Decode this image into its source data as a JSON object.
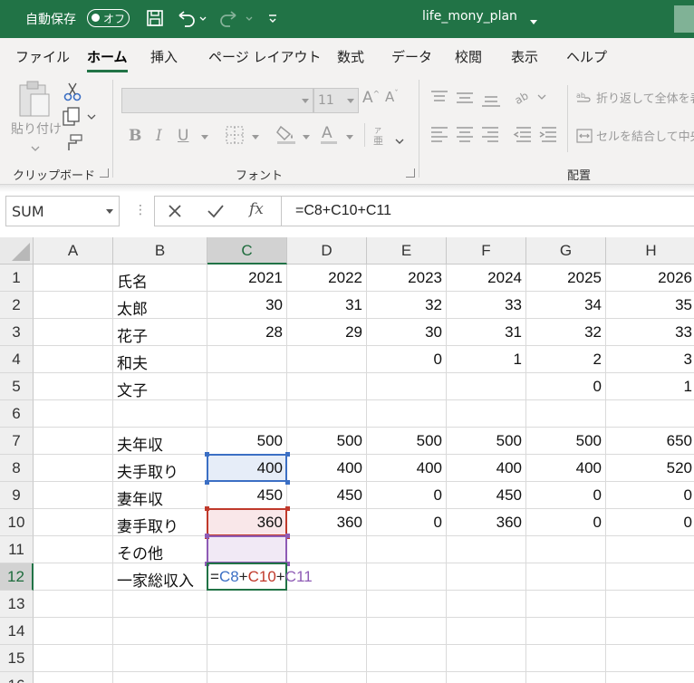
{
  "titlebar": {
    "autosave_label": "自動保存",
    "autosave_toggle": "オフ",
    "file_title": "life_mony_plan"
  },
  "menu": {
    "tabs": [
      "ファイル",
      "ホーム",
      "挿入",
      "ページ レイアウト",
      "数式",
      "データ",
      "校閲",
      "表示",
      "ヘルプ"
    ],
    "active_tab": "ホーム"
  },
  "ribbon": {
    "clipboard": {
      "paste_label": "貼り付け",
      "group_label": "クリップボード"
    },
    "font": {
      "group_label": "フォント",
      "font_size": "11"
    },
    "alignment": {
      "group_label": "配置",
      "wrap_text": "折り返して全体を表",
      "merge_center": "セルを結合して中央"
    }
  },
  "formula_bar": {
    "name_box": "SUM",
    "formula": "=C8+C10+C11"
  },
  "sheet": {
    "columns": [
      "A",
      "B",
      "C",
      "D",
      "E",
      "F",
      "G",
      "H"
    ],
    "selected_column": "C",
    "selected_row": 12,
    "rows": [
      {
        "num": "1",
        "A": "",
        "B": "氏名",
        "C": "2021",
        "D": "2022",
        "E": "2023",
        "F": "2024",
        "G": "2025",
        "H": "2026"
      },
      {
        "num": "2",
        "A": "",
        "B": "太郎",
        "C": "30",
        "D": "31",
        "E": "32",
        "F": "33",
        "G": "34",
        "H": "35"
      },
      {
        "num": "3",
        "A": "",
        "B": "花子",
        "C": "28",
        "D": "29",
        "E": "30",
        "F": "31",
        "G": "32",
        "H": "33"
      },
      {
        "num": "4",
        "A": "",
        "B": "和夫",
        "C": "",
        "D": "",
        "E": "0",
        "F": "1",
        "G": "2",
        "H": "3"
      },
      {
        "num": "5",
        "A": "",
        "B": "文子",
        "C": "",
        "D": "",
        "E": "",
        "F": "",
        "G": "0",
        "H": "1"
      },
      {
        "num": "6",
        "A": "",
        "B": "",
        "C": "",
        "D": "",
        "E": "",
        "F": "",
        "G": "",
        "H": ""
      },
      {
        "num": "7",
        "A": "",
        "B": "夫年収",
        "C": "500",
        "D": "500",
        "E": "500",
        "F": "500",
        "G": "500",
        "H": "650"
      },
      {
        "num": "8",
        "A": "",
        "B": "夫手取り",
        "C": "400",
        "D": "400",
        "E": "400",
        "F": "400",
        "G": "400",
        "H": "520"
      },
      {
        "num": "9",
        "A": "",
        "B": "妻年収",
        "C": "450",
        "D": "450",
        "E": "0",
        "F": "450",
        "G": "0",
        "H": "0"
      },
      {
        "num": "10",
        "A": "",
        "B": "妻手取り",
        "C": "360",
        "D": "360",
        "E": "0",
        "F": "360",
        "G": "0",
        "H": "0"
      },
      {
        "num": "11",
        "A": "",
        "B": "その他",
        "C": "",
        "D": "",
        "E": "",
        "F": "",
        "G": "",
        "H": ""
      },
      {
        "num": "12",
        "A": "",
        "B": "一家総収入",
        "C": "",
        "D": "",
        "E": "",
        "F": "",
        "G": "",
        "H": ""
      },
      {
        "num": "13",
        "A": "",
        "B": "",
        "C": "",
        "D": "",
        "E": "",
        "F": "",
        "G": "",
        "H": ""
      },
      {
        "num": "14",
        "A": "",
        "B": "",
        "C": "",
        "D": "",
        "E": "",
        "F": "",
        "G": "",
        "H": ""
      },
      {
        "num": "15",
        "A": "",
        "B": "",
        "C": "",
        "D": "",
        "E": "",
        "F": "",
        "G": "",
        "H": ""
      },
      {
        "num": "16",
        "A": "",
        "B": "",
        "C": "",
        "D": "",
        "E": "",
        "F": "",
        "G": "",
        "H": ""
      }
    ],
    "editing_formula_parts": [
      {
        "text": "=",
        "color": "#222222"
      },
      {
        "text": "C8",
        "color": "#3b6fc4"
      },
      {
        "text": "+",
        "color": "#222222"
      },
      {
        "text": "C10",
        "color": "#c0392b"
      },
      {
        "text": "+",
        "color": "#222222"
      },
      {
        "text": "C11",
        "color": "#8e5bb5"
      }
    ],
    "colors": {
      "accent": "#217346",
      "ref_blue": "#3b6fc4",
      "ref_red": "#c0392b",
      "ref_purple": "#8e5bb5"
    }
  }
}
